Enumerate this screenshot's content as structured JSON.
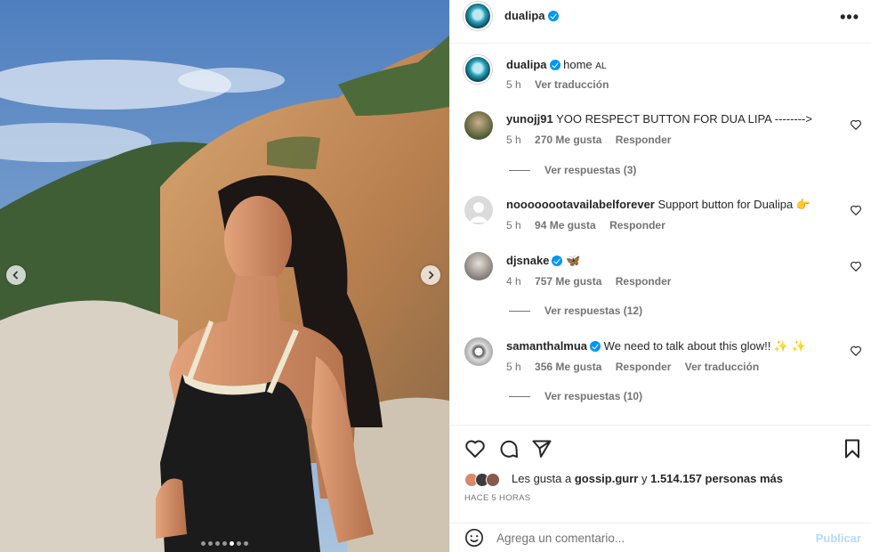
{
  "post": {
    "author": "dualipa",
    "caption_username": "dualipa",
    "caption_text": "home",
    "caption_flag": "AL",
    "caption_time": "5 h",
    "caption_translate": "Ver traducción",
    "more_icon": "more-horizontal-icon",
    "carousel_dot_count": 7,
    "carousel_active_index": 4
  },
  "comments": [
    {
      "username": "yunojj91",
      "verified": false,
      "text": "YOO RESPECT BUTTON FOR DUA LIPA -------->",
      "time": "5 h",
      "likes": "270 Me gusta",
      "reply": "Responder",
      "translate": "",
      "replies": "Ver respuestas (3)"
    },
    {
      "username": "noooooootavailabelforever",
      "verified": false,
      "text": "Support button for Dualipa 👉",
      "time": "5 h",
      "likes": "94 Me gusta",
      "reply": "Responder",
      "translate": "",
      "replies": ""
    },
    {
      "username": "djsnake",
      "verified": true,
      "text": "🦋",
      "time": "4 h",
      "likes": "757 Me gusta",
      "reply": "Responder",
      "translate": "",
      "replies": "Ver respuestas (12)"
    },
    {
      "username": "samanthalmua",
      "verified": true,
      "text": "We need to talk about this glow!! ✨ ✨",
      "time": "5 h",
      "likes": "356 Me gusta",
      "reply": "Responder",
      "translate": "Ver traducción",
      "replies": "Ver respuestas (10)"
    }
  ],
  "likes": {
    "prefix": "Les gusta a",
    "first_user": "gossip.gurr",
    "joiner": "y",
    "others": "1.514.157 personas más"
  },
  "time_ago": "HACE 5 HORAS",
  "composer": {
    "placeholder": "Agrega un comentario...",
    "publish_label": "Publicar"
  },
  "colors": {
    "accent": "#0095f6",
    "publish_disabled": "#b3dbff",
    "muted": "#737373"
  }
}
